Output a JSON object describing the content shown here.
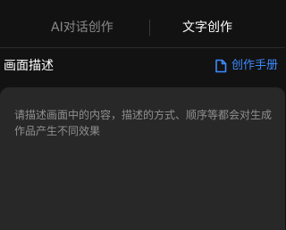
{
  "tabs": [
    {
      "label": "AI对话创作",
      "active": false
    },
    {
      "label": "文字创作",
      "active": true
    }
  ],
  "section": {
    "title": "画面描述",
    "manual_link": "创作手册",
    "manual_icon": "document-icon"
  },
  "prompt": {
    "placeholder": "请描述画面中的内容，描述的方式、顺序等都会对生成作品产生不同效果"
  },
  "colors": {
    "background": "#121212",
    "accent": "#3d8bff",
    "panel": "#282828",
    "muted_text": "#8a8a8a"
  }
}
